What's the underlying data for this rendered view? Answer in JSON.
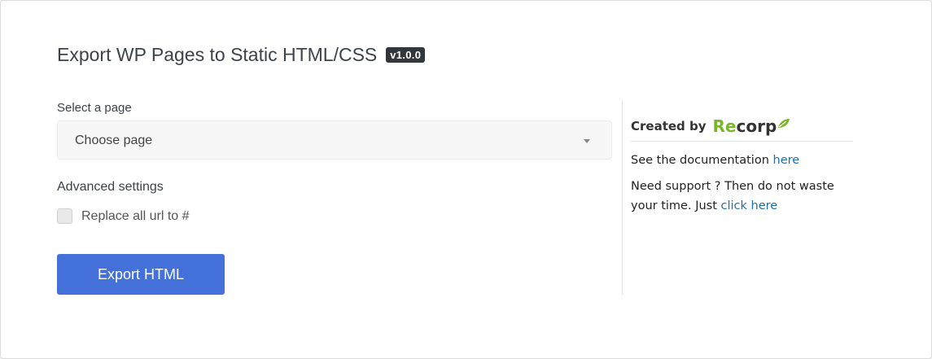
{
  "header": {
    "title": "Export WP Pages to Static HTML/CSS",
    "version": "v1.0.0"
  },
  "form": {
    "select_label": "Select a page",
    "select_value": "Choose page",
    "advanced_label": "Advanced settings",
    "checkbox_label": "Replace all url to #",
    "checkbox_checked": false,
    "export_button": "Export HTML"
  },
  "sidebar": {
    "created_by": "Created by",
    "brand_prefix": "Re",
    "brand_suffix": "corp",
    "doc_text": "See the documentation ",
    "doc_link": "here",
    "support_text": "Need support ? Then do not waste your time. Just ",
    "support_link": "click here"
  },
  "colors": {
    "accent": "#4370d9",
    "brand_green": "#79b62a",
    "link": "#1e6fa8"
  }
}
